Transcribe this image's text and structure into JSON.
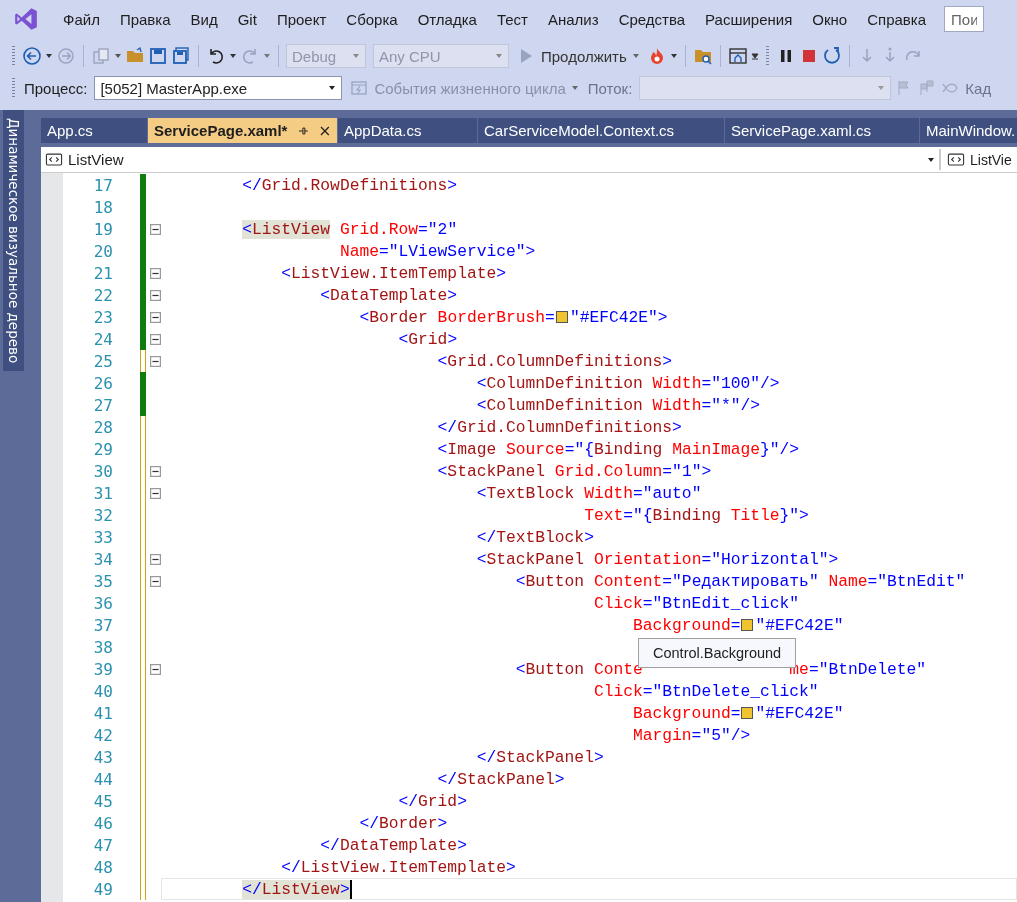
{
  "menu": [
    {
      "label": "Файл"
    },
    {
      "label": "Правка"
    },
    {
      "label": "Вид"
    },
    {
      "label": "Git"
    },
    {
      "label": "Проект"
    },
    {
      "label": "Сборка"
    },
    {
      "label": "Отладка"
    },
    {
      "label": "Тест"
    },
    {
      "label": "Анализ"
    },
    {
      "label": "Средства"
    },
    {
      "label": "Расширения"
    },
    {
      "label": "Окно"
    },
    {
      "label": "Справка"
    }
  ],
  "search": {
    "placeholder": "Пои"
  },
  "toolbar": {
    "configuration": {
      "value": "Debug",
      "disabled": true
    },
    "platform": {
      "value": "Any CPU",
      "disabled": true
    },
    "continue": {
      "label": "Продолжить"
    }
  },
  "debug_bar": {
    "process_label": "Процесс:",
    "process": "[5052] MasterApp.exe",
    "lifecycle": {
      "label": "События жизненного цикла",
      "disabled": true
    },
    "thread_label": "Поток:",
    "frame_label": "Кад"
  },
  "side_panel": {
    "label": "Динамическое визуальное дерево"
  },
  "tabs": [
    {
      "label": "App.cs",
      "selected": false
    },
    {
      "label": "ServicePage.xaml*",
      "selected": true
    },
    {
      "label": "AppData.cs",
      "selected": false
    },
    {
      "label": "CarServiceModel.Context.cs",
      "selected": false
    },
    {
      "label": "ServicePage.xaml.cs",
      "selected": false
    },
    {
      "label": "MainWindow.",
      "selected": false
    }
  ],
  "nav": {
    "left": "ListView",
    "right": "ListVie"
  },
  "lines": [
    {
      "number": "17",
      "saved": true,
      "fold": false,
      "current": false,
      "tokens": [
        {
          "kind": "p",
          "text": "        </"
        },
        {
          "kind": "el",
          "text": "Grid.RowDefinitions"
        },
        {
          "kind": "p",
          "text": ">"
        }
      ]
    },
    {
      "number": "18",
      "saved": true,
      "fold": false,
      "current": false
    },
    {
      "number": "19",
      "saved": true,
      "fold": true,
      "current": false,
      "tokens": [
        {
          "kind": "p",
          "text": "        <",
          "hl": true
        },
        {
          "kind": "el",
          "text": "ListView",
          "hl": true
        },
        {
          "kind": "at",
          "text": " Grid.Row"
        },
        {
          "kind": "p",
          "text": "=\"2\""
        }
      ]
    },
    {
      "number": "20",
      "saved": true,
      "fold": false,
      "current": false,
      "tokens": [
        {
          "kind": "at",
          "text": "                  Name"
        },
        {
          "kind": "p",
          "text": "=\"LViewService\">"
        }
      ]
    },
    {
      "number": "21",
      "saved": true,
      "fold": true,
      "current": false,
      "tokens": [
        {
          "kind": "p",
          "text": "            <"
        },
        {
          "kind": "el",
          "text": "ListView.ItemTemplate"
        },
        {
          "kind": "p",
          "text": ">"
        }
      ]
    },
    {
      "number": "22",
      "saved": true,
      "fold": true,
      "current": false,
      "tokens": [
        {
          "kind": "p",
          "text": "                <"
        },
        {
          "kind": "el",
          "text": "DataTemplate"
        },
        {
          "kind": "p",
          "text": ">"
        }
      ]
    },
    {
      "number": "23",
      "saved": true,
      "fold": true,
      "current": false,
      "tokens": [
        {
          "kind": "p",
          "text": "                    <"
        },
        {
          "kind": "el",
          "text": "Border"
        },
        {
          "kind": "at",
          "text": " BorderBrush"
        },
        {
          "kind": "p",
          "text": "="
        },
        {
          "kind": "swatch",
          "color": "#efc42e"
        },
        {
          "kind": "p",
          "text": "\"#EFC42E\">"
        }
      ]
    },
    {
      "number": "24",
      "saved": true,
      "fold": true,
      "current": false,
      "tokens": [
        {
          "kind": "p",
          "text": "                        <"
        },
        {
          "kind": "el",
          "text": "Grid"
        },
        {
          "kind": "p",
          "text": ">"
        }
      ]
    },
    {
      "number": "25",
      "saved": false,
      "fold": true,
      "current": false,
      "tokens": [
        {
          "kind": "p",
          "text": "                            <"
        },
        {
          "kind": "el",
          "text": "Grid.ColumnDefinitions"
        },
        {
          "kind": "p",
          "text": ">"
        }
      ]
    },
    {
      "number": "26",
      "saved": true,
      "fold": false,
      "current": false,
      "tokens": [
        {
          "kind": "p",
          "text": "                                <"
        },
        {
          "kind": "el",
          "text": "ColumnDefinition"
        },
        {
          "kind": "at",
          "text": " Width"
        },
        {
          "kind": "p",
          "text": "=\"100\"/>"
        }
      ]
    },
    {
      "number": "27",
      "saved": true,
      "fold": false,
      "current": false,
      "tokens": [
        {
          "kind": "p",
          "text": "                                <"
        },
        {
          "kind": "el",
          "text": "ColumnDefinition"
        },
        {
          "kind": "at",
          "text": " Width"
        },
        {
          "kind": "p",
          "text": "=\"*\"/>"
        }
      ]
    },
    {
      "number": "28",
      "saved": false,
      "fold": false,
      "current": false,
      "tokens": [
        {
          "kind": "p",
          "text": "                            </"
        },
        {
          "kind": "el",
          "text": "Grid.ColumnDefinitions"
        },
        {
          "kind": "p",
          "text": ">"
        }
      ]
    },
    {
      "number": "29",
      "saved": false,
      "fold": false,
      "current": false,
      "tokens": [
        {
          "kind": "p",
          "text": "                            <"
        },
        {
          "kind": "el",
          "text": "Image"
        },
        {
          "kind": "at",
          "text": " Source"
        },
        {
          "kind": "p",
          "text": "=\"{"
        },
        {
          "kind": "el",
          "text": "Binding"
        },
        {
          "kind": "at",
          "text": " MainImage"
        },
        {
          "kind": "p",
          "text": "}\"/>"
        }
      ]
    },
    {
      "number": "30",
      "saved": false,
      "fold": true,
      "current": false,
      "tokens": [
        {
          "kind": "p",
          "text": "                            <"
        },
        {
          "kind": "el",
          "text": "StackPanel"
        },
        {
          "kind": "at",
          "text": " Grid.Column"
        },
        {
          "kind": "p",
          "text": "=\"1\">"
        }
      ]
    },
    {
      "number": "31",
      "saved": false,
      "fold": true,
      "current": false,
      "tokens": [
        {
          "kind": "p",
          "text": "                                <"
        },
        {
          "kind": "el",
          "text": "TextBlock"
        },
        {
          "kind": "at",
          "text": " Width"
        },
        {
          "kind": "p",
          "text": "=\"auto\""
        }
      ]
    },
    {
      "number": "32",
      "saved": false,
      "fold": false,
      "current": false,
      "tokens": [
        {
          "kind": "at",
          "text": "                                           Text"
        },
        {
          "kind": "p",
          "text": "=\"{"
        },
        {
          "kind": "el",
          "text": "Binding"
        },
        {
          "kind": "at",
          "text": " Title"
        },
        {
          "kind": "p",
          "text": "}\">"
        }
      ]
    },
    {
      "number": "33",
      "saved": false,
      "fold": false,
      "current": false,
      "tokens": [
        {
          "kind": "p",
          "text": "                                </"
        },
        {
          "kind": "el",
          "text": "TextBlock"
        },
        {
          "kind": "p",
          "text": ">"
        }
      ]
    },
    {
      "number": "34",
      "saved": false,
      "fold": true,
      "current": false,
      "tokens": [
        {
          "kind": "p",
          "text": "                                <"
        },
        {
          "kind": "el",
          "text": "StackPanel"
        },
        {
          "kind": "at",
          "text": " Orientation"
        },
        {
          "kind": "p",
          "text": "=\"Horizontal\">"
        }
      ]
    },
    {
      "number": "35",
      "saved": false,
      "fold": true,
      "current": false,
      "tokens": [
        {
          "kind": "p",
          "text": "                                    <"
        },
        {
          "kind": "el",
          "text": "Button"
        },
        {
          "kind": "at",
          "text": " Content"
        },
        {
          "kind": "p",
          "text": "=\"Редактировать\""
        },
        {
          "kind": "at",
          "text": " Name"
        },
        {
          "kind": "p",
          "text": "=\"BtnEdit\""
        }
      ]
    },
    {
      "number": "36",
      "saved": false,
      "fold": false,
      "current": false,
      "tokens": [
        {
          "kind": "at",
          "text": "                                            Click"
        },
        {
          "kind": "p",
          "text": "=\"BtnEdit_click\""
        }
      ]
    },
    {
      "number": "37",
      "saved": false,
      "fold": false,
      "current": false,
      "tokens": [
        {
          "kind": "at",
          "text": "                                                Background"
        },
        {
          "kind": "p",
          "text": "="
        },
        {
          "kind": "swatch",
          "color": "#efc42e"
        },
        {
          "kind": "p",
          "text": "\"#EFC42E\""
        }
      ]
    },
    {
      "number": "38",
      "saved": false,
      "fold": false,
      "current": false
    },
    {
      "number": "39",
      "saved": false,
      "fold": true,
      "current": false,
      "tokens": [
        {
          "kind": "p",
          "text": "                                    <"
        },
        {
          "kind": "el",
          "text": "Button"
        },
        {
          "kind": "at",
          "text": " Conte"
        },
        {
          "kind": "at",
          "text": "               me"
        },
        {
          "kind": "p",
          "text": "=\"BtnDelete\""
        }
      ]
    },
    {
      "number": "40",
      "saved": false,
      "fold": false,
      "current": false,
      "tokens": [
        {
          "kind": "at",
          "text": "                                            Click"
        },
        {
          "kind": "p",
          "text": "=\"BtnDelete_click\""
        }
      ]
    },
    {
      "number": "41",
      "saved": false,
      "fold": false,
      "current": false,
      "tokens": [
        {
          "kind": "at",
          "text": "                                                Background"
        },
        {
          "kind": "p",
          "text": "="
        },
        {
          "kind": "swatch",
          "color": "#efc42e"
        },
        {
          "kind": "p",
          "text": "\"#EFC42E\""
        }
      ]
    },
    {
      "number": "42",
      "saved": false,
      "fold": false,
      "current": false,
      "tokens": [
        {
          "kind": "at",
          "text": "                                                Margin"
        },
        {
          "kind": "p",
          "text": "=\"5\"/>"
        }
      ]
    },
    {
      "number": "43",
      "saved": false,
      "fold": false,
      "current": false,
      "tokens": [
        {
          "kind": "p",
          "text": "                                </"
        },
        {
          "kind": "el",
          "text": "StackPanel"
        },
        {
          "kind": "p",
          "text": ">"
        }
      ]
    },
    {
      "number": "44",
      "saved": false,
      "fold": false,
      "current": false,
      "tokens": [
        {
          "kind": "p",
          "text": "                            </"
        },
        {
          "kind": "el",
          "text": "StackPanel"
        },
        {
          "kind": "p",
          "text": ">"
        }
      ]
    },
    {
      "number": "45",
      "saved": false,
      "fold": false,
      "current": false,
      "tokens": [
        {
          "kind": "p",
          "text": "                        </"
        },
        {
          "kind": "el",
          "text": "Grid"
        },
        {
          "kind": "p",
          "text": ">"
        }
      ]
    },
    {
      "number": "46",
      "saved": false,
      "fold": false,
      "current": false,
      "tokens": [
        {
          "kind": "p",
          "text": "                    </"
        },
        {
          "kind": "el",
          "text": "Border"
        },
        {
          "kind": "p",
          "text": ">"
        }
      ]
    },
    {
      "number": "47",
      "saved": false,
      "fold": false,
      "current": false,
      "tokens": [
        {
          "kind": "p",
          "text": "                </"
        },
        {
          "kind": "el",
          "text": "DataTemplate"
        },
        {
          "kind": "p",
          "text": ">"
        }
      ]
    },
    {
      "number": "48",
      "saved": false,
      "fold": false,
      "current": false,
      "tokens": [
        {
          "kind": "p",
          "text": "            </"
        },
        {
          "kind": "el",
          "text": "ListView.ItemTemplate"
        },
        {
          "kind": "p",
          "text": ">"
        }
      ]
    },
    {
      "number": "49",
      "saved": false,
      "fold": false,
      "current": true,
      "tokens": [
        {
          "kind": "p",
          "text": "        </",
          "hl": true
        },
        {
          "kind": "el",
          "text": "ListView",
          "hl": true
        },
        {
          "kind": "p",
          "text": ">",
          "hl": true
        }
      ]
    }
  ],
  "tooltip": {
    "text": "Control.Background"
  }
}
